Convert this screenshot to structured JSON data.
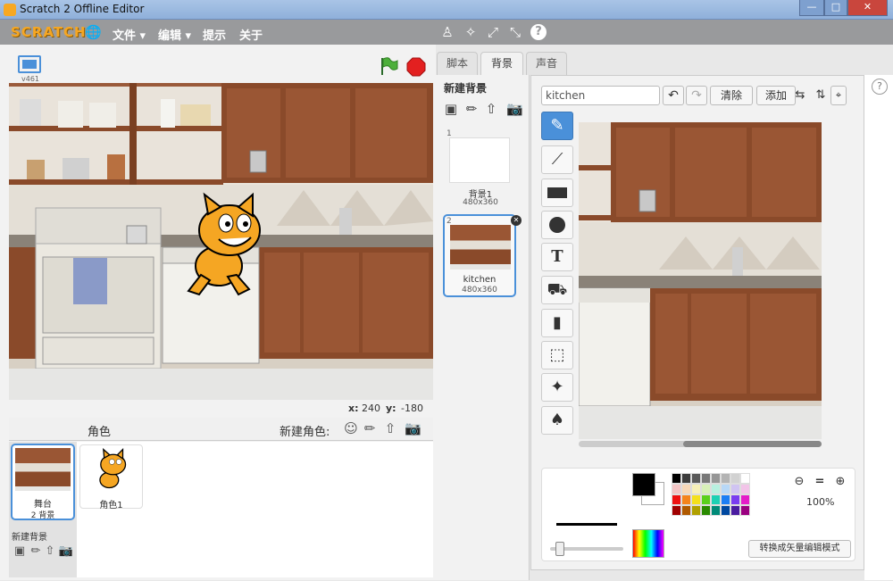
{
  "window": {
    "title": "Scratch 2 Offline Editor"
  },
  "menubar": {
    "logo": "SCRATCH",
    "items": [
      "文件 ▾",
      "编辑 ▾",
      "提示",
      "关于"
    ]
  },
  "stage": {
    "version": "v461",
    "coord_x_label": "x:",
    "coord_x": "240",
    "coord_y_label": "y:",
    "coord_y": "-180"
  },
  "sprites": {
    "header": "角色",
    "new_sprite_label": "新建角色:",
    "stage_item": {
      "name": "舞台",
      "sub": "2 背景"
    },
    "new_backdrop_label": "新建背景",
    "items": [
      {
        "name": "角色1"
      }
    ]
  },
  "tabs": [
    "脚本",
    "背景",
    "声音"
  ],
  "backdrops": {
    "header": "新建背景",
    "items": [
      {
        "num": "1",
        "name": "背景1",
        "size": "480x360"
      },
      {
        "num": "2",
        "name": "kitchen",
        "size": "480x360"
      }
    ]
  },
  "editor": {
    "name_value": "kitchen",
    "clear_label": "清除",
    "add_label": "添加",
    "zoom_label": "100%",
    "convert_label": "转换成矢量编辑模式"
  },
  "colors": {
    "accent": "#4a90d9",
    "menubar": "#999a9c",
    "logo": "#f5a623"
  },
  "palette": [
    "#000000",
    "#3c3c3c",
    "#5a5a5a",
    "#787878",
    "#969696",
    "#b4b4b4",
    "#d2d2d2",
    "#ffffff",
    "#f2c4c4",
    "#f7d8b8",
    "#f7f0b8",
    "#d8f0b8",
    "#b8f0e0",
    "#b8d8f7",
    "#d0c4f2",
    "#f2c4e8",
    "#ee1111",
    "#f4841c",
    "#f4e01c",
    "#5ad01c",
    "#1cd0b4",
    "#1c7ef4",
    "#7a3cf0",
    "#e41cc8",
    "#a00000",
    "#b05a00",
    "#b0a000",
    "#2a8a00",
    "#008a78",
    "#0048a0",
    "#4a1ca0",
    "#9a0080"
  ]
}
